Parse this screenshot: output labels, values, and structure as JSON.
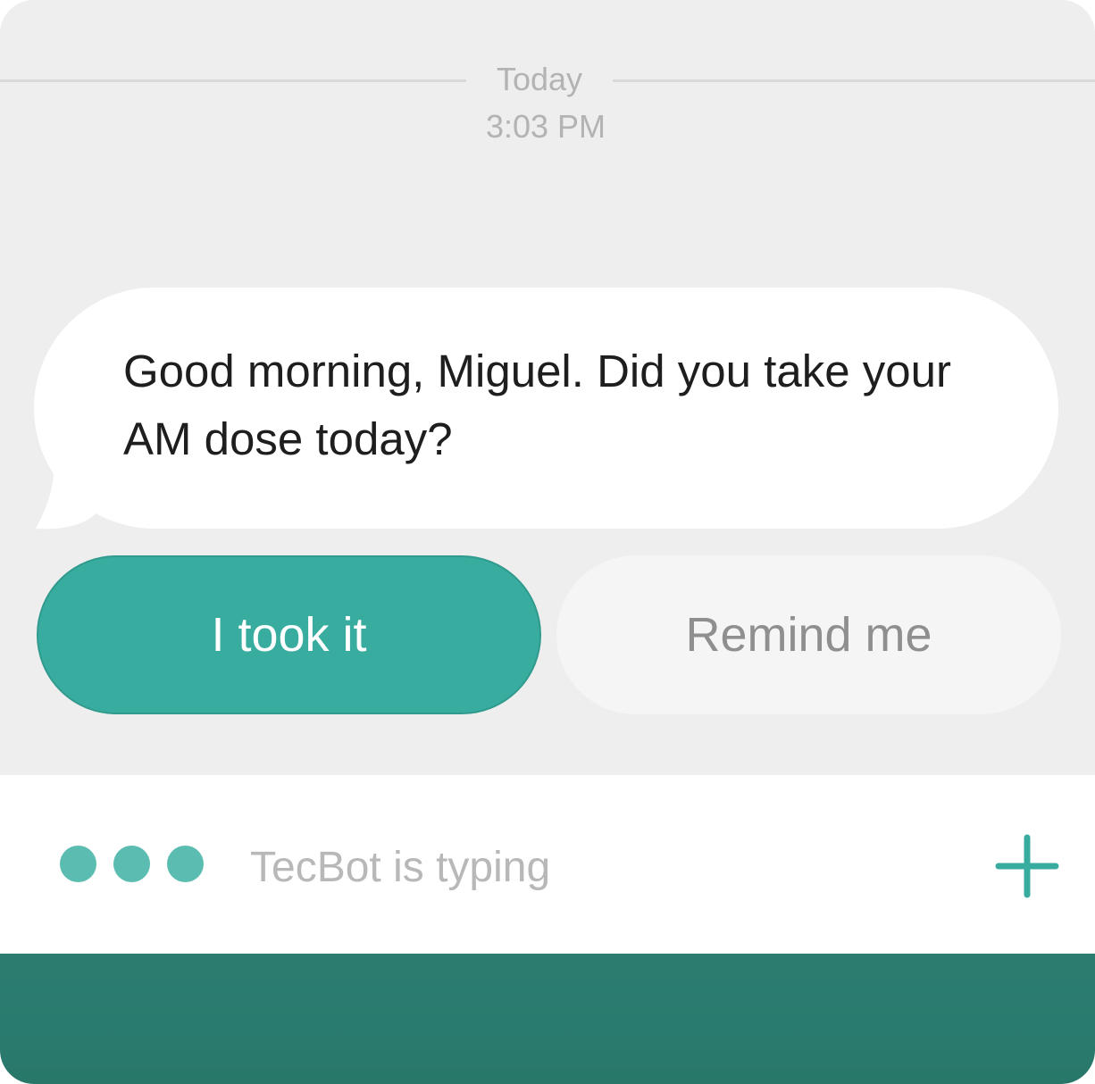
{
  "header": {
    "date_label": "Today",
    "time_label": "3:03 PM"
  },
  "message": {
    "text": "Good morning, Miguel. Did you take your AM dose today?"
  },
  "actions": {
    "primary_label": "I took it",
    "secondary_label": "Remind me"
  },
  "typing": {
    "label": "TecBot is typing",
    "indicator_icon": "typing-dots-icon",
    "add_icon": "plus-icon"
  },
  "colors": {
    "accent": "#38ad9f",
    "footer": "#2a7b6f",
    "background": "#eeeeee"
  }
}
